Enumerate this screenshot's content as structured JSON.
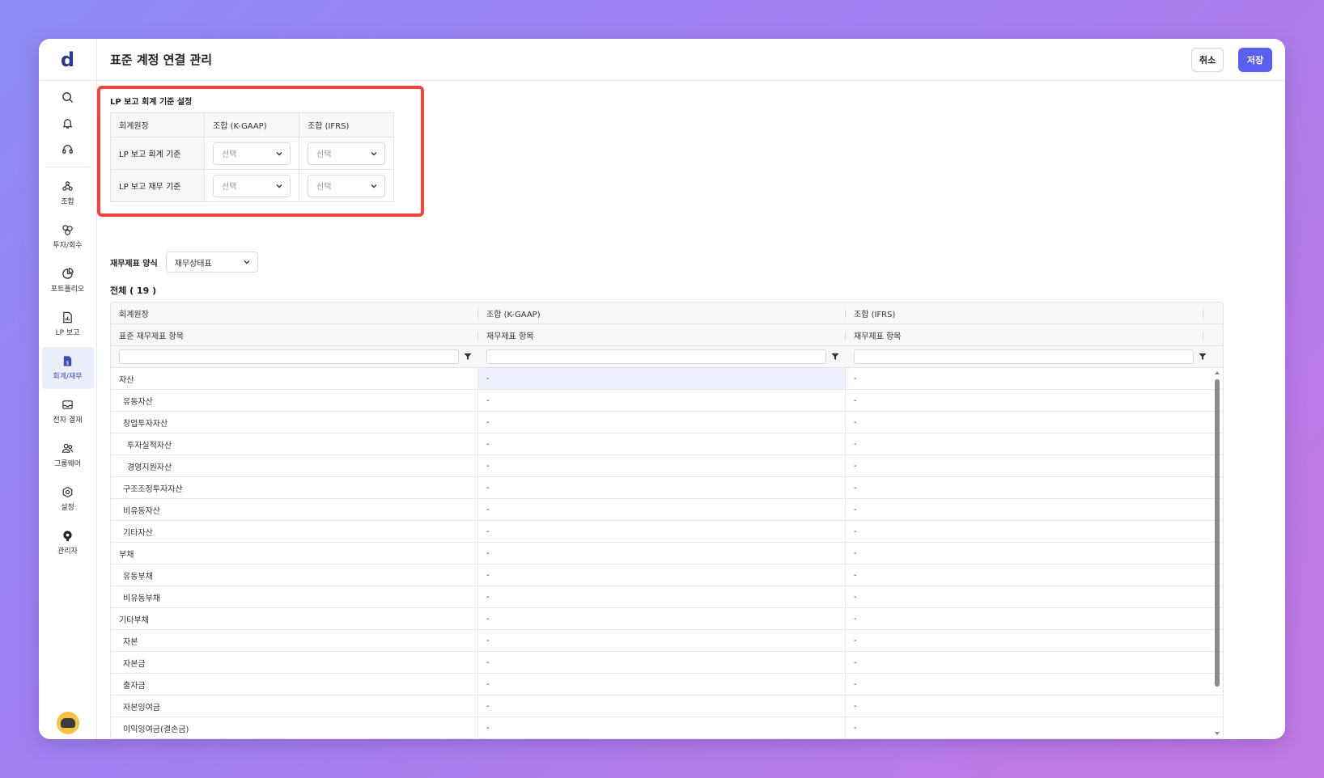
{
  "app": {
    "logo": "d",
    "title": "표준 계정 연결 관리"
  },
  "header": {
    "cancel_label": "취소",
    "save_label": "저장"
  },
  "sidebar": {
    "top_icons": [
      "search-icon",
      "bell-icon",
      "headset-icon"
    ],
    "items": [
      {
        "label": "조합",
        "icon": "fund-icon"
      },
      {
        "label": "투자/회수",
        "icon": "invest-icon"
      },
      {
        "label": "포트폴리오",
        "icon": "pie-icon"
      },
      {
        "label": "LP 보고",
        "icon": "report-icon"
      },
      {
        "label": "회계/재무",
        "icon": "accounting-icon",
        "active": true
      },
      {
        "label": "전자 결재",
        "icon": "mail-icon"
      },
      {
        "label": "그룹웨어",
        "icon": "group-icon"
      },
      {
        "label": "설정",
        "icon": "gear-icon"
      },
      {
        "label": "관리자",
        "icon": "admin-icon"
      }
    ]
  },
  "lp_settings": {
    "title": "LP 보고 회계 기준 설정",
    "columns": [
      "회계원장",
      "조합 (K-GAAP)",
      "조합 (IFRS)"
    ],
    "rows": [
      {
        "label": "LP 보고 회계 기준",
        "kgaap": "선택",
        "ifrs": "선택"
      },
      {
        "label": "LP 보고 재무 기준",
        "kgaap": "선택",
        "ifrs": "선택"
      }
    ]
  },
  "format": {
    "label": "재무제표 양식",
    "value": "재무상태표"
  },
  "total_label": "전체 ( 19 )",
  "grid": {
    "header1": [
      "회계원장",
      "조합 (K-GAAP)",
      "조합 (IFRS)"
    ],
    "header2": [
      "표준 재무제표 항목",
      "재무제표 항목",
      "재무제표 항목"
    ],
    "rows": [
      {
        "name": "자산",
        "level": 0,
        "kgaap": "-",
        "ifrs": "-"
      },
      {
        "name": "유동자산",
        "level": 1,
        "kgaap": "-",
        "ifrs": "-"
      },
      {
        "name": "창업투자자산",
        "level": 1,
        "kgaap": "-",
        "ifrs": "-"
      },
      {
        "name": "투자실적자산",
        "level": 2,
        "kgaap": "-",
        "ifrs": "-"
      },
      {
        "name": "경영지원자산",
        "level": 2,
        "kgaap": "-",
        "ifrs": "-"
      },
      {
        "name": "구조조정투자자산",
        "level": 1,
        "kgaap": "-",
        "ifrs": "-"
      },
      {
        "name": "비유동자산",
        "level": 1,
        "kgaap": "-",
        "ifrs": "-"
      },
      {
        "name": "기타자산",
        "level": 1,
        "kgaap": "-",
        "ifrs": "-"
      },
      {
        "name": "부채",
        "level": 0,
        "kgaap": "-",
        "ifrs": "-"
      },
      {
        "name": "유동부채",
        "level": 1,
        "kgaap": "-",
        "ifrs": "-"
      },
      {
        "name": "비유동부채",
        "level": 1,
        "kgaap": "-",
        "ifrs": "-"
      },
      {
        "name": "기타부채",
        "level": 0,
        "kgaap": "-",
        "ifrs": "-"
      },
      {
        "name": "자본",
        "level": 1,
        "kgaap": "-",
        "ifrs": "-"
      },
      {
        "name": "자본금",
        "level": 1,
        "kgaap": "-",
        "ifrs": "-"
      },
      {
        "name": "출자금",
        "level": 1,
        "kgaap": "-",
        "ifrs": "-"
      },
      {
        "name": "자본잉여금",
        "level": 1,
        "kgaap": "-",
        "ifrs": "-"
      },
      {
        "name": "이익잉여금(결손금)",
        "level": 1,
        "kgaap": "-",
        "ifrs": "-"
      }
    ]
  },
  "colors": {
    "accent": "#5b5ff0",
    "highlight_border": "#f0443a",
    "selected_cell": "#eef0fb"
  }
}
